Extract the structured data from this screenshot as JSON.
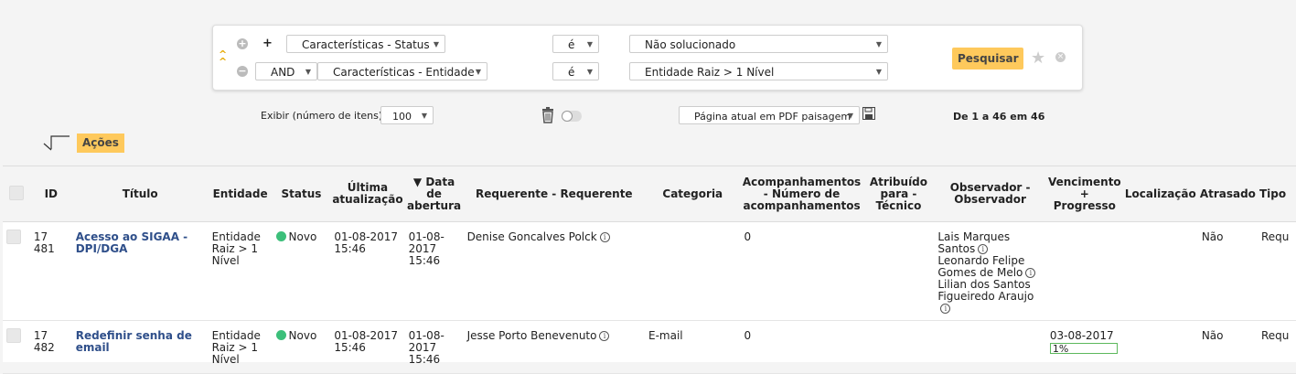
{
  "search": {
    "row1": {
      "add_icon": "plus-icon",
      "criteria": "Características - Status",
      "operator": "é",
      "value": "Não solucionado"
    },
    "row2": {
      "logic": "AND",
      "criteria": "Características - Entidade",
      "operator": "é",
      "value": "Entidade Raiz > 1 Nível"
    },
    "search_button": "Pesquisar",
    "plus_label": "+"
  },
  "toolbar": {
    "display_label": "Exibir (número de itens)",
    "display_value": "100",
    "export_value": "Página atual em PDF paisagem",
    "pagination": "De 1 a 46 em 46",
    "actions_label": "Ações"
  },
  "table": {
    "headers": {
      "id": "ID",
      "title": "Título",
      "entity": "Entidade",
      "status": "Status",
      "last_update_1": "Última",
      "last_update_2": "atualização",
      "open_date_1": "▼ Data",
      "open_date_2": "de",
      "open_date_3": "abertura",
      "requester": "Requerente - Requerente",
      "category": "Categoria",
      "followups_1": "Acompanhamentos",
      "followups_2": "- Número de",
      "followups_3": "acompanhamentos",
      "assigned_1": "Atribuído",
      "assigned_2": "para -",
      "assigned_3": "Técnico",
      "observer_1": "Observador -",
      "observer_2": "Observador",
      "due_1": "Vencimento",
      "due_2": "+",
      "due_3": "Progresso",
      "location": "Localização",
      "late": "Atrasado",
      "type": "Tipo"
    },
    "rows": [
      {
        "id": "17 481",
        "title_1": "Acesso ao SIGAA -",
        "title_2": "DPI/DGA",
        "entity_1": "Entidade",
        "entity_2": "Raiz > 1",
        "entity_3": "Nível",
        "status": "Novo",
        "last_update_1": "01-08-2017",
        "last_update_2": "15:46",
        "open_1": "01-08-",
        "open_2": "2017",
        "open_3": "15:46",
        "requester": "Denise Goncalves Polck",
        "category": "",
        "followups": "0",
        "observers": [
          "Lais Marques",
          "Santos",
          "Leonardo Felipe",
          "Gomes de Melo",
          "Lilian dos Santos",
          "Figueiredo Araujo"
        ],
        "due": "",
        "progress": "",
        "late": "Não",
        "type": "Requ"
      },
      {
        "id": "17 482",
        "title_1": "Redefinir senha de",
        "title_2": "email",
        "entity_1": "Entidade",
        "entity_2": "Raiz > 1",
        "entity_3": "Nível",
        "status": "Novo",
        "last_update_1": "01-08-2017",
        "last_update_2": "15:46",
        "open_1": "01-08-",
        "open_2": "2017",
        "open_3": "15:46",
        "requester": "Jesse Porto Benevenuto",
        "category": "E-mail",
        "followups": "0",
        "due": "03-08-2017",
        "progress": "1%",
        "late": "Não",
        "type": "Requ"
      }
    ]
  },
  "colors": {
    "accent": "#fec95c",
    "link": "#2f4f8a",
    "status_new": "#3cbf7a",
    "progress_border": "#5cb85c"
  },
  "icons": {
    "info": "i"
  }
}
